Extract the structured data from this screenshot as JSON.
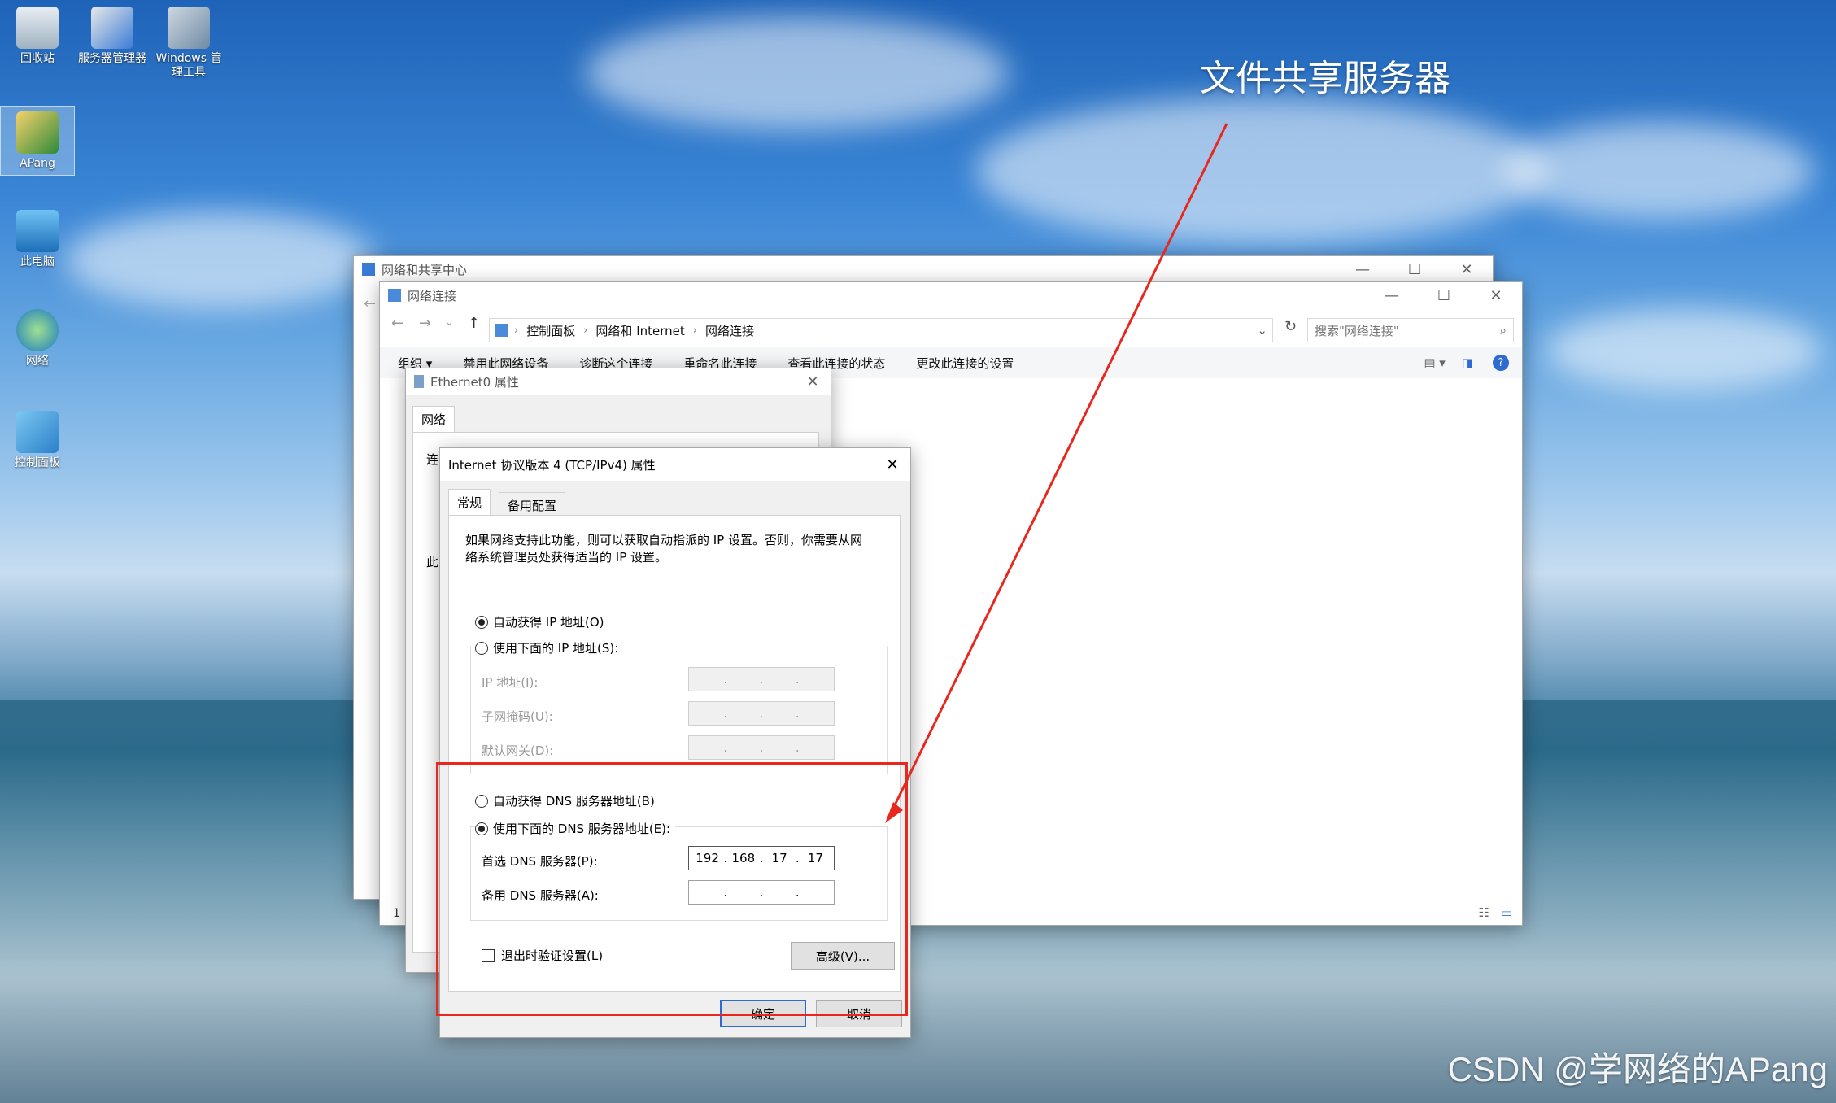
{
  "desktop": {
    "icons": [
      {
        "label": "回收站"
      },
      {
        "label": "服务器管理器"
      },
      {
        "label": "Windows 管理工具"
      },
      {
        "label": "APang"
      },
      {
        "label": "此电脑"
      },
      {
        "label": "网络"
      },
      {
        "label": "控制面板"
      }
    ]
  },
  "overlay_title": "文件共享服务器",
  "watermark": "CSDN @学网络的APang",
  "win_sharing_center": {
    "title": "网络和共享中心"
  },
  "win_network_connections": {
    "title": "网络连接",
    "breadcrumb": [
      "控制面板",
      "网络和 Internet",
      "网络连接"
    ],
    "search_placeholder": "搜索\"网络连接\"",
    "commands": [
      "组织 ▾",
      "禁用此网络设备",
      "诊断这个连接",
      "重命名此连接",
      "查看此连接的状态",
      "更改此连接的设置"
    ],
    "status_count": "1"
  },
  "win_ethernet": {
    "title": "Ethernet0 属性",
    "tab": "网络",
    "partial_label_1": "连",
    "partial_label_2": "此"
  },
  "ipv4_dialog": {
    "title": "Internet 协议版本 4 (TCP/IPv4) 属性",
    "tabs": [
      "常规",
      "备用配置"
    ],
    "description": "如果网络支持此功能，则可以获取自动指派的 IP 设置。否则，你需要从网络系统管理员处获得适当的 IP 设置。",
    "auto_ip": "自动获得 IP 地址(O)",
    "manual_ip": "使用下面的 IP 地址(S):",
    "ip_label": "IP 地址(I):",
    "mask_label": "子网掩码(U):",
    "gateway_label": "默认网关(D):",
    "auto_dns": "自动获得 DNS 服务器地址(B)",
    "manual_dns": "使用下面的 DNS 服务器地址(E):",
    "preferred_dns_label": "首选 DNS 服务器(P):",
    "preferred_dns": [
      "192",
      "168",
      "17",
      "17"
    ],
    "alternate_dns_label": "备用 DNS 服务器(A):",
    "validate_label": "退出时验证设置(L)",
    "advanced_button": "高级(V)...",
    "ok_button": "确定",
    "cancel_button": "取消"
  },
  "colors": {
    "annotation_red": "#e8281f",
    "accent_blue": "#2d6ad1"
  }
}
